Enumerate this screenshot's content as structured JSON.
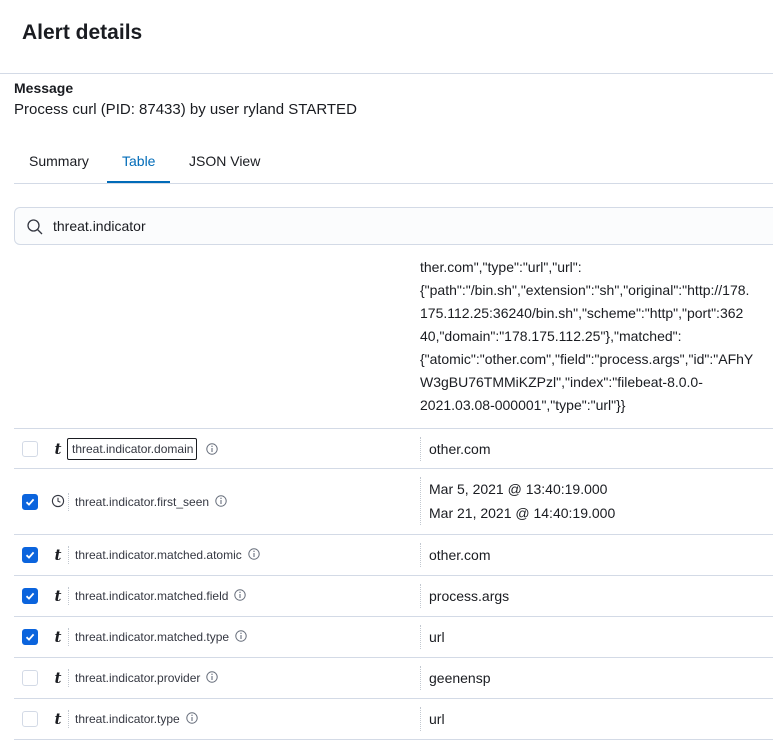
{
  "header": {
    "title": "Alert details"
  },
  "message": {
    "label": "Message",
    "text": "Process curl (PID: 87433) by user ryland STARTED"
  },
  "tabs": [
    {
      "label": "Summary",
      "active": false
    },
    {
      "label": "Table",
      "active": true
    },
    {
      "label": "JSON View",
      "active": false
    }
  ],
  "search": {
    "value": "threat.indicator",
    "icon": "search-icon"
  },
  "json_preview": {
    "lines": [
      "ther.com\",\"type\":\"url\",\"url\":",
      "{\"path\":\"/bin.sh\",\"extension\":\"sh\",\"original\":\"http://178.",
      "175.112.25:36240/bin.sh\",\"scheme\":\"http\",\"port\":362",
      "40,\"domain\":\"178.175.112.25\"},\"matched\":",
      "{\"atomic\":\"other.com\",\"field\":\"process.args\",\"id\":\"AFhY",
      "W3gBU76TMMiKZPzl\",\"index\":\"filebeat-8.0.0-",
      "2021.03.08-000001\",\"type\":\"url\"}}"
    ]
  },
  "rows": [
    {
      "field": "threat.indicator.domain",
      "type_icon": "string-icon",
      "checked": false,
      "values": [
        "other.com"
      ]
    },
    {
      "field": "threat.indicator.first_seen",
      "type_icon": "clock-icon",
      "checked": true,
      "values": [
        "Mar 5, 2021 @ 13:40:19.000",
        "Mar 21, 2021 @ 14:40:19.000"
      ]
    },
    {
      "field": "threat.indicator.matched.atomic",
      "type_icon": "string-icon",
      "checked": true,
      "values": [
        "other.com"
      ]
    },
    {
      "field": "threat.indicator.matched.field",
      "type_icon": "string-icon",
      "checked": true,
      "values": [
        "process.args"
      ]
    },
    {
      "field": "threat.indicator.matched.type",
      "type_icon": "string-icon",
      "checked": true,
      "values": [
        "url"
      ]
    },
    {
      "field": "threat.indicator.provider",
      "type_icon": "string-icon",
      "checked": false,
      "values": [
        "geenensp"
      ]
    },
    {
      "field": "threat.indicator.type",
      "type_icon": "string-icon",
      "checked": false,
      "values": [
        "url"
      ]
    }
  ],
  "colors": {
    "accent": "#006bb8",
    "checkbox": "#0b64dd",
    "border": "#d3dae6"
  }
}
